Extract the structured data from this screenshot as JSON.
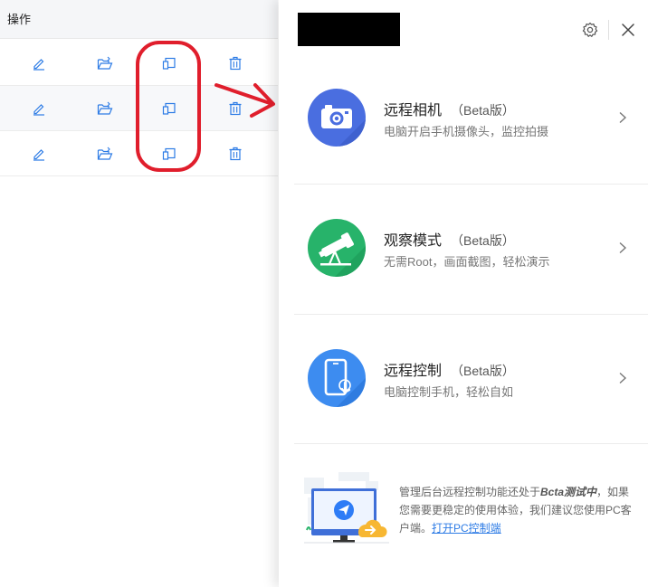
{
  "table": {
    "header": "操作",
    "rows": [
      {
        "actions": [
          "edit-icon",
          "folder-open-icon",
          "remote-device-icon",
          "trash-icon"
        ]
      },
      {
        "actions": [
          "edit-icon",
          "folder-open-icon",
          "remote-device-icon",
          "trash-icon"
        ]
      },
      {
        "actions": [
          "edit-icon",
          "folder-open-icon",
          "remote-device-icon",
          "trash-icon"
        ]
      }
    ]
  },
  "panel": {
    "header_icons": [
      "settings-icon",
      "close-icon"
    ],
    "features": [
      {
        "title": "远程相机",
        "badge": "（Beta版）",
        "subtitle": "电脑开启手机摄像头，监控拍摄",
        "icon": "camera-icon",
        "color": "#4a6ee0"
      },
      {
        "title": "观察模式",
        "badge": "（Beta版）",
        "subtitle": "无需Root，画面截图，轻松演示",
        "icon": "telescope-icon",
        "color": "#27b36a"
      },
      {
        "title": "远程控制",
        "badge": "（Beta版）",
        "subtitle": "电脑控制手机，轻松自如",
        "icon": "phone-touch-icon",
        "color": "#3d8cf0"
      }
    ],
    "footer": {
      "text_before": "管理后台远程控制功能还处于",
      "emphasis": "Bcta测试中",
      "text_after": "，如果您需要更稳定的使用体验，我们建议您使用PC客户端。",
      "link": "打开PC控制端"
    }
  },
  "colors": {
    "accent": "#2c7be5",
    "annotation": "#e01e2c"
  }
}
